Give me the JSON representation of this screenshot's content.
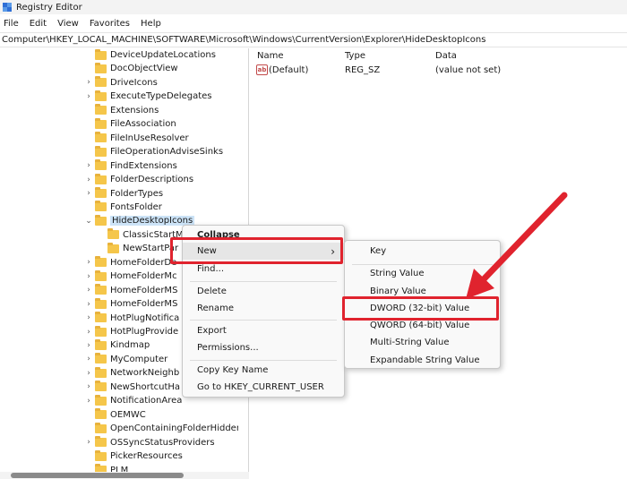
{
  "window": {
    "title": "Registry Editor"
  },
  "menubar": {
    "items": [
      "File",
      "Edit",
      "View",
      "Favorites",
      "Help"
    ]
  },
  "address": {
    "path": "Computer\\HKEY_LOCAL_MACHINE\\SOFTWARE\\Microsoft\\Windows\\CurrentVersion\\Explorer\\HideDesktopIcons"
  },
  "tree": {
    "items": [
      {
        "label": "DeviceUpdateLocations",
        "expandable": false
      },
      {
        "label": "DocObjectView",
        "expandable": false
      },
      {
        "label": "DriveIcons",
        "expandable": true
      },
      {
        "label": "ExecuteTypeDelegates",
        "expandable": true
      },
      {
        "label": "Extensions",
        "expandable": false
      },
      {
        "label": "FileAssociation",
        "expandable": false
      },
      {
        "label": "FileInUseResolver",
        "expandable": false
      },
      {
        "label": "FileOperationAdviseSinks",
        "expandable": false
      },
      {
        "label": "FindExtensions",
        "expandable": true
      },
      {
        "label": "FolderDescriptions",
        "expandable": true
      },
      {
        "label": "FolderTypes",
        "expandable": true
      },
      {
        "label": "FontsFolder",
        "expandable": false
      },
      {
        "label": "HideDesktopIcons",
        "expandable": true,
        "expanded": true,
        "selected": true
      },
      {
        "label": "ClassicStartM",
        "expandable": false,
        "child": true
      },
      {
        "label": "NewStartPar",
        "expandable": false,
        "child": true
      },
      {
        "label": "HomeFolderDe",
        "expandable": true
      },
      {
        "label": "HomeFolderMc",
        "expandable": true
      },
      {
        "label": "HomeFolderMS",
        "expandable": true
      },
      {
        "label": "HomeFolderMS",
        "expandable": true
      },
      {
        "label": "HotPlugNotifica",
        "expandable": true
      },
      {
        "label": "HotPlugProvide",
        "expandable": true
      },
      {
        "label": "Kindmap",
        "expandable": true
      },
      {
        "label": "MyComputer",
        "expandable": true
      },
      {
        "label": "NetworkNeighb",
        "expandable": true
      },
      {
        "label": "NewShortcutHa",
        "expandable": true
      },
      {
        "label": "NotificationArea",
        "expandable": true
      },
      {
        "label": "OEMWC",
        "expandable": false
      },
      {
        "label": "OpenContainingFolderHiddenLis",
        "expandable": false
      },
      {
        "label": "OSSyncStatusProviders",
        "expandable": true
      },
      {
        "label": "PickerResources",
        "expandable": false
      },
      {
        "label": "PLM",
        "expandable": false
      }
    ]
  },
  "list": {
    "columns": {
      "name": "Name",
      "type": "Type",
      "data": "Data"
    },
    "rows": [
      {
        "name": "(Default)",
        "type": "REG_SZ",
        "data": "(value not set)",
        "icon": "string-value-icon"
      }
    ]
  },
  "context_menu": {
    "items": [
      "Collapse",
      "New",
      "Find...",
      "Delete",
      "Rename",
      "Export",
      "Permissions...",
      "Copy Key Name",
      "Go to HKEY_CURRENT_USER"
    ],
    "submenu_arrow": "›"
  },
  "submenu": {
    "items": [
      "Key",
      "String Value",
      "Binary Value",
      "DWORD (32-bit) Value",
      "QWORD (64-bit) Value",
      "Multi-String Value",
      "Expandable String Value"
    ]
  },
  "colors": {
    "highlight": "#e0232e",
    "selection": "#cce3f7",
    "folder": "#f5c64a"
  }
}
